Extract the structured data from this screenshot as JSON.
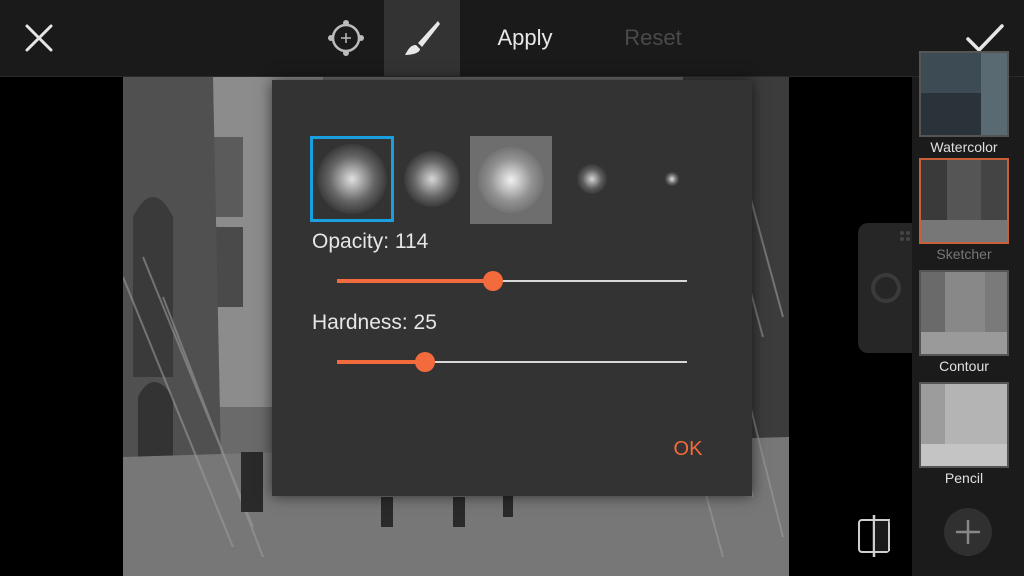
{
  "toolbar": {
    "apply_label": "Apply",
    "reset_label": "Reset",
    "icons": [
      "close-icon",
      "target-icon",
      "brush-icon",
      "checkmark-icon"
    ]
  },
  "dialog": {
    "brushes": [
      {
        "name": "soft-large",
        "selected": true
      },
      {
        "name": "soft-medium",
        "selected": false
      },
      {
        "name": "square-soft",
        "selected": false
      },
      {
        "name": "soft-small",
        "selected": false
      },
      {
        "name": "soft-tiny",
        "selected": false
      }
    ],
    "opacity": {
      "label": "Opacity: 114",
      "value": 114,
      "max": 255
    },
    "hardness": {
      "label": "Hardness: 25",
      "value": 25,
      "max": 100
    },
    "ok_label": "OK"
  },
  "effects": [
    {
      "label": "Watercolor",
      "selected": false
    },
    {
      "label": "Sketcher",
      "selected": true
    },
    {
      "label": "Contour",
      "selected": false
    },
    {
      "label": "Pencil",
      "selected": false
    }
  ],
  "colors": {
    "accent": "#f36a3c",
    "selection": "#18a0e0",
    "effect_selected": "#c8603a"
  }
}
